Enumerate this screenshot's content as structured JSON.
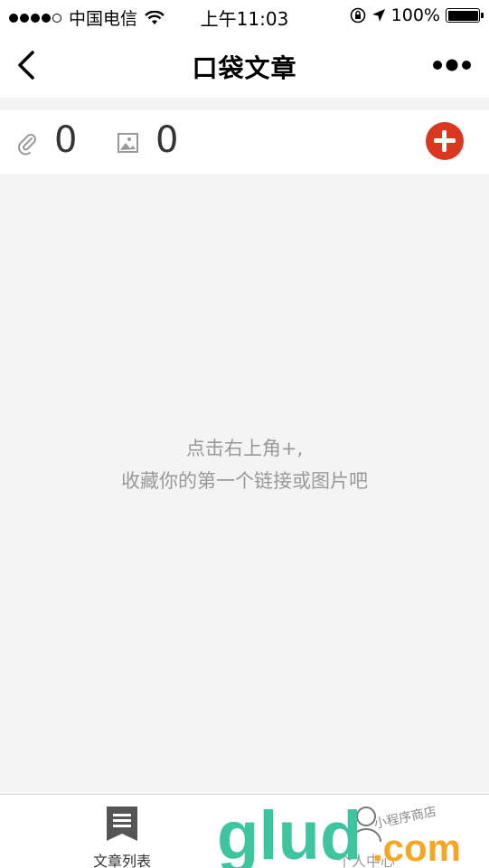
{
  "status_bar": {
    "carrier": "中国电信",
    "time": "上午11:03",
    "battery": "100%",
    "battery_level": 1.0,
    "signal_bars_filled": 4,
    "signal_bars_total": 5,
    "icons": [
      "wifi-icon",
      "rotation-lock-icon",
      "location-arrow-icon",
      "battery-icon"
    ]
  },
  "nav": {
    "title": "口袋文章",
    "back_icon": "chevron-left-icon",
    "more_icon": "more-dots-icon"
  },
  "counters": {
    "links_count": "0",
    "images_count": "0",
    "links_icon": "paperclip-icon",
    "images_icon": "image-icon",
    "add_icon": "plus-circle-icon"
  },
  "empty_state": {
    "line1": "点击右上角+,",
    "line2": "收藏你的第一个链接或图片吧"
  },
  "tab_bar": {
    "tabs": [
      {
        "label": "文章列表",
        "icon": "article-list-icon",
        "active": true
      },
      {
        "label": "个人中心",
        "icon": "person-icon",
        "active": false
      }
    ]
  },
  "watermark": {
    "text": "glud.com",
    "subtext": "小程序商店"
  },
  "colors": {
    "accent": "#d9381e",
    "background": "#f4f4f4",
    "hint_text": "#999999",
    "watermark_green": "#3ec5a0",
    "watermark_orange": "#f5a623"
  }
}
